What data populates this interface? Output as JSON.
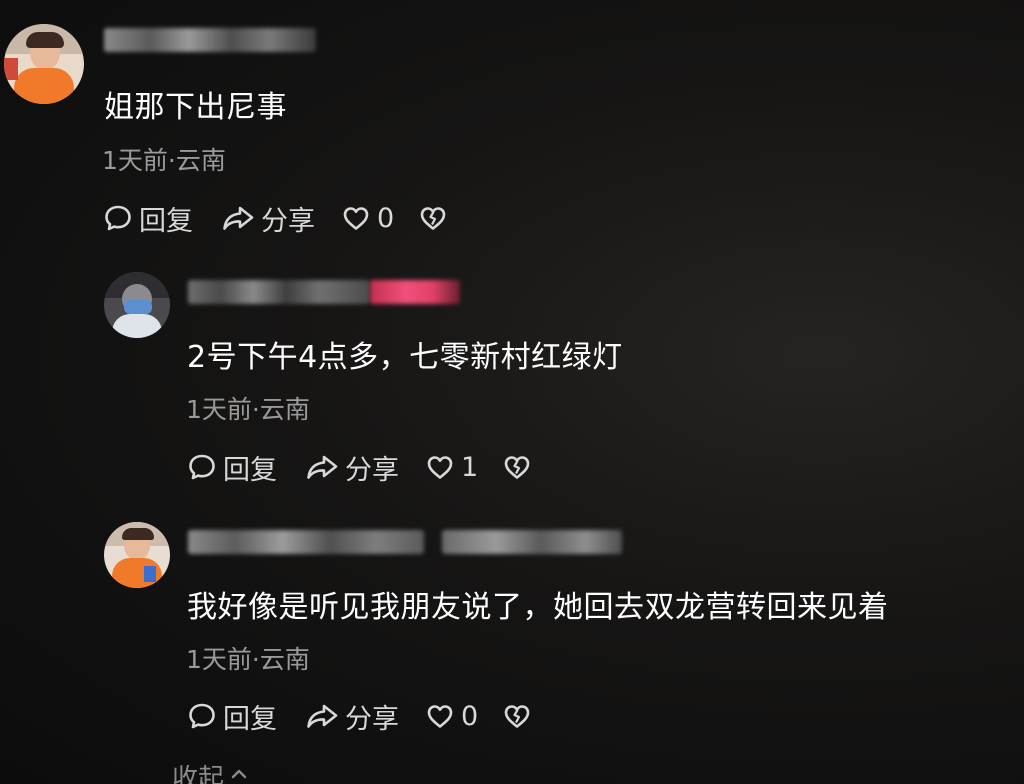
{
  "comments": [
    {
      "text": "姐那下出尼事",
      "meta": "1天前·云南",
      "actions": {
        "reply": "回复",
        "share": "分享",
        "likes": "0"
      }
    },
    {
      "text": "2号下午4点多，七零新村红绿灯",
      "meta": "1天前·云南",
      "actions": {
        "reply": "回复",
        "share": "分享",
        "likes": "1"
      }
    },
    {
      "text": "我好像是听见我朋友说了，她回去双龙营转回来见着",
      "meta": "1天前·云南",
      "actions": {
        "reply": "回复",
        "share": "分享",
        "likes": "0"
      }
    }
  ],
  "collapse_label": "收起",
  "icons": {
    "reply": "comment-bubble-icon",
    "share": "share-arrow-icon",
    "like": "heart-icon",
    "dislike": "broken-heart-icon",
    "collapse": "chevron-up-icon"
  }
}
